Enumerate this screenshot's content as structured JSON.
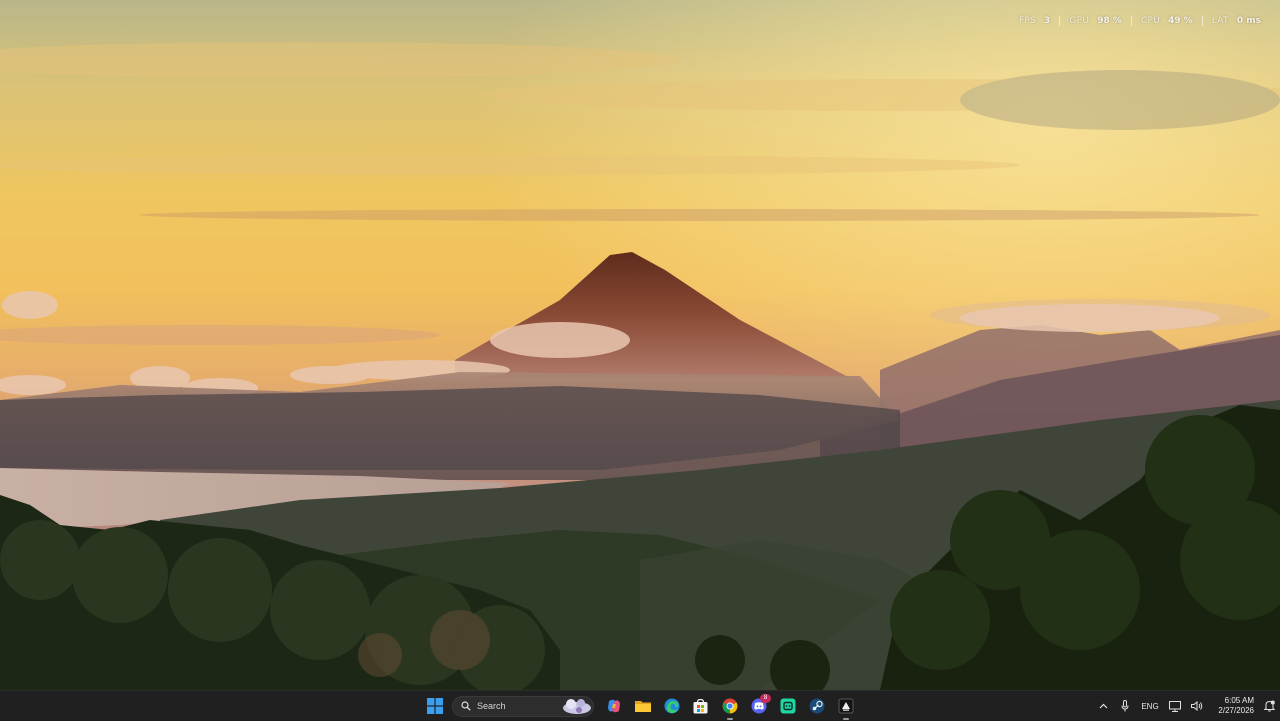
{
  "perf_overlay": {
    "items": [
      {
        "label": "FPS",
        "value": "3"
      },
      {
        "label": "GPU",
        "value": "98 %"
      },
      {
        "label": "CPU",
        "value": "49 %"
      },
      {
        "label": "LAT",
        "value": "0 ms"
      }
    ]
  },
  "taskbar": {
    "search_label": "Search",
    "apps": [
      {
        "name": "start",
        "icon": "windows-logo-icon"
      },
      {
        "name": "copilot",
        "icon": "copilot-icon"
      },
      {
        "name": "file-explorer",
        "icon": "folder-icon"
      },
      {
        "name": "edge",
        "icon": "edge-browser-icon"
      },
      {
        "name": "store",
        "icon": "store-icon"
      },
      {
        "name": "chrome",
        "icon": "chrome-icon",
        "active": true
      },
      {
        "name": "discord",
        "icon": "discord-icon",
        "badge": "8"
      },
      {
        "name": "terminal-app",
        "icon": "app-icon"
      },
      {
        "name": "steam",
        "icon": "steam-icon"
      },
      {
        "name": "capture",
        "icon": "capture-app-icon",
        "active": true
      }
    ],
    "tray": {
      "language": "ENG",
      "time": "6:05 AM",
      "date": "2/27/2026"
    }
  },
  "wallpaper": {
    "subject": "volcano-sunrise",
    "colors": {
      "sky_top": "#c9b77d",
      "sky_glow": "#f2c35a",
      "mountain": "#6e3a2c",
      "forest": "#1f2a17"
    }
  }
}
